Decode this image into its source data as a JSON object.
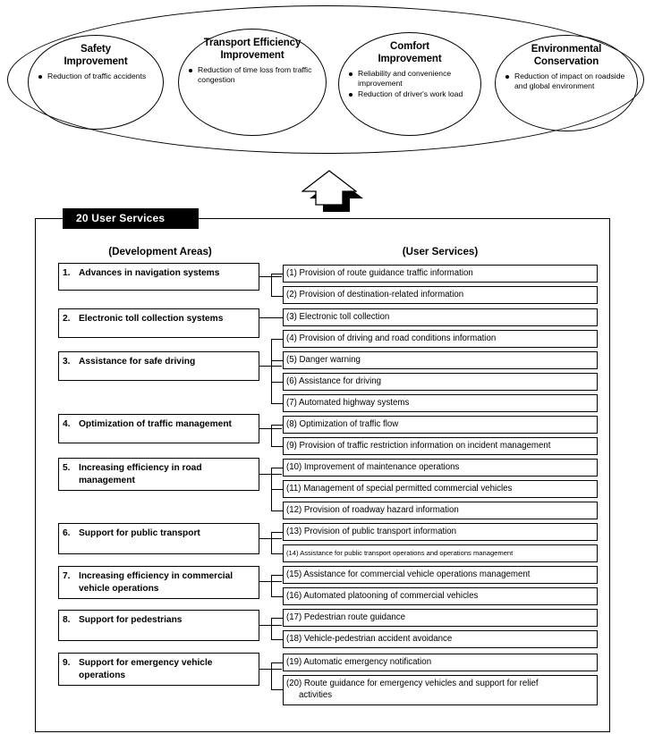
{
  "goals": {
    "items": [
      {
        "title_line1": "Safety",
        "title_line2": "Improvement",
        "bullets": [
          "Reduction of traffic accidents"
        ]
      },
      {
        "title_line1": "Transport Efficiency",
        "title_line2": "Improvement",
        "bullets": [
          "Reduction of time loss from traffic congestion"
        ]
      },
      {
        "title_line1": "Comfort",
        "title_line2": "Improvement",
        "bullets": [
          "Reliability and convenience improvement",
          "Reduction of driver's work load"
        ]
      },
      {
        "title_line1": "Environmental",
        "title_line2": "Conservation",
        "bullets": [
          "Reduction of impact on roadside and global environment"
        ]
      }
    ]
  },
  "panel": {
    "tag_label": "20 User Services",
    "column_header_left": "(Development Areas)",
    "column_header_right": "(User Services)"
  },
  "development_areas": [
    {
      "number": "1.",
      "text": "Advances in navigation systems",
      "line2": ""
    },
    {
      "number": "2.",
      "text": "Electronic toll collection systems",
      "line2": ""
    },
    {
      "number": "3.",
      "text": "Assistance for safe driving",
      "line2": ""
    },
    {
      "number": "4.",
      "text": "Optimization of traffic management",
      "line2": ""
    },
    {
      "number": "5.",
      "text": "Increasing efficiency in road",
      "line2": "management"
    },
    {
      "number": "6.",
      "text": "Support for public transport",
      "line2": ""
    },
    {
      "number": "7.",
      "text": "Increasing efficiency in commercial",
      "line2": "vehicle operations"
    },
    {
      "number": "8.",
      "text": "Support for pedestrians",
      "line2": ""
    },
    {
      "number": "9.",
      "text": "Support for emergency vehicle",
      "line2": "operations"
    }
  ],
  "user_services": [
    {
      "label": "(1) Provision of route guidance traffic information",
      "line2": ""
    },
    {
      "label": "(2) Provision of destination-related information",
      "line2": ""
    },
    {
      "label": "(3) Electronic toll collection",
      "line2": ""
    },
    {
      "label": "(4) Provision of driving and road conditions information",
      "line2": ""
    },
    {
      "label": "(5) Danger warning",
      "line2": ""
    },
    {
      "label": "(6) Assistance for driving",
      "line2": ""
    },
    {
      "label": "(7) Automated highway systems",
      "line2": ""
    },
    {
      "label": "(8) Optimization of traffic flow",
      "line2": ""
    },
    {
      "label": "(9) Provision of traffic restriction information on incident management",
      "line2": ""
    },
    {
      "label": "(10) Improvement of maintenance operations",
      "line2": ""
    },
    {
      "label": "(11) Management of special permitted commercial vehicles",
      "line2": ""
    },
    {
      "label": "(12) Provision of roadway hazard information",
      "line2": ""
    },
    {
      "label": "(13) Provision of public transport information",
      "line2": ""
    },
    {
      "label": "(14) Assistance for public transport operations and operations management",
      "line2": ""
    },
    {
      "label": "(15) Assistance for commercial vehicle operations management",
      "line2": ""
    },
    {
      "label": "(16) Automated platooning of commercial vehicles",
      "line2": ""
    },
    {
      "label": "(17) Pedestrian route guidance",
      "line2": ""
    },
    {
      "label": "(18) Vehicle-pedestrian accident avoidance",
      "line2": ""
    },
    {
      "label": "(19) Automatic emergency notification",
      "line2": ""
    },
    {
      "label": "(20) Route guidance for emergency vehicles and support for relief",
      "line2": "activities"
    }
  ],
  "colors": {
    "line": "#000000",
    "tag_background": "#000000",
    "tag_text": "#ffffff",
    "page_background": "#ffffff"
  }
}
